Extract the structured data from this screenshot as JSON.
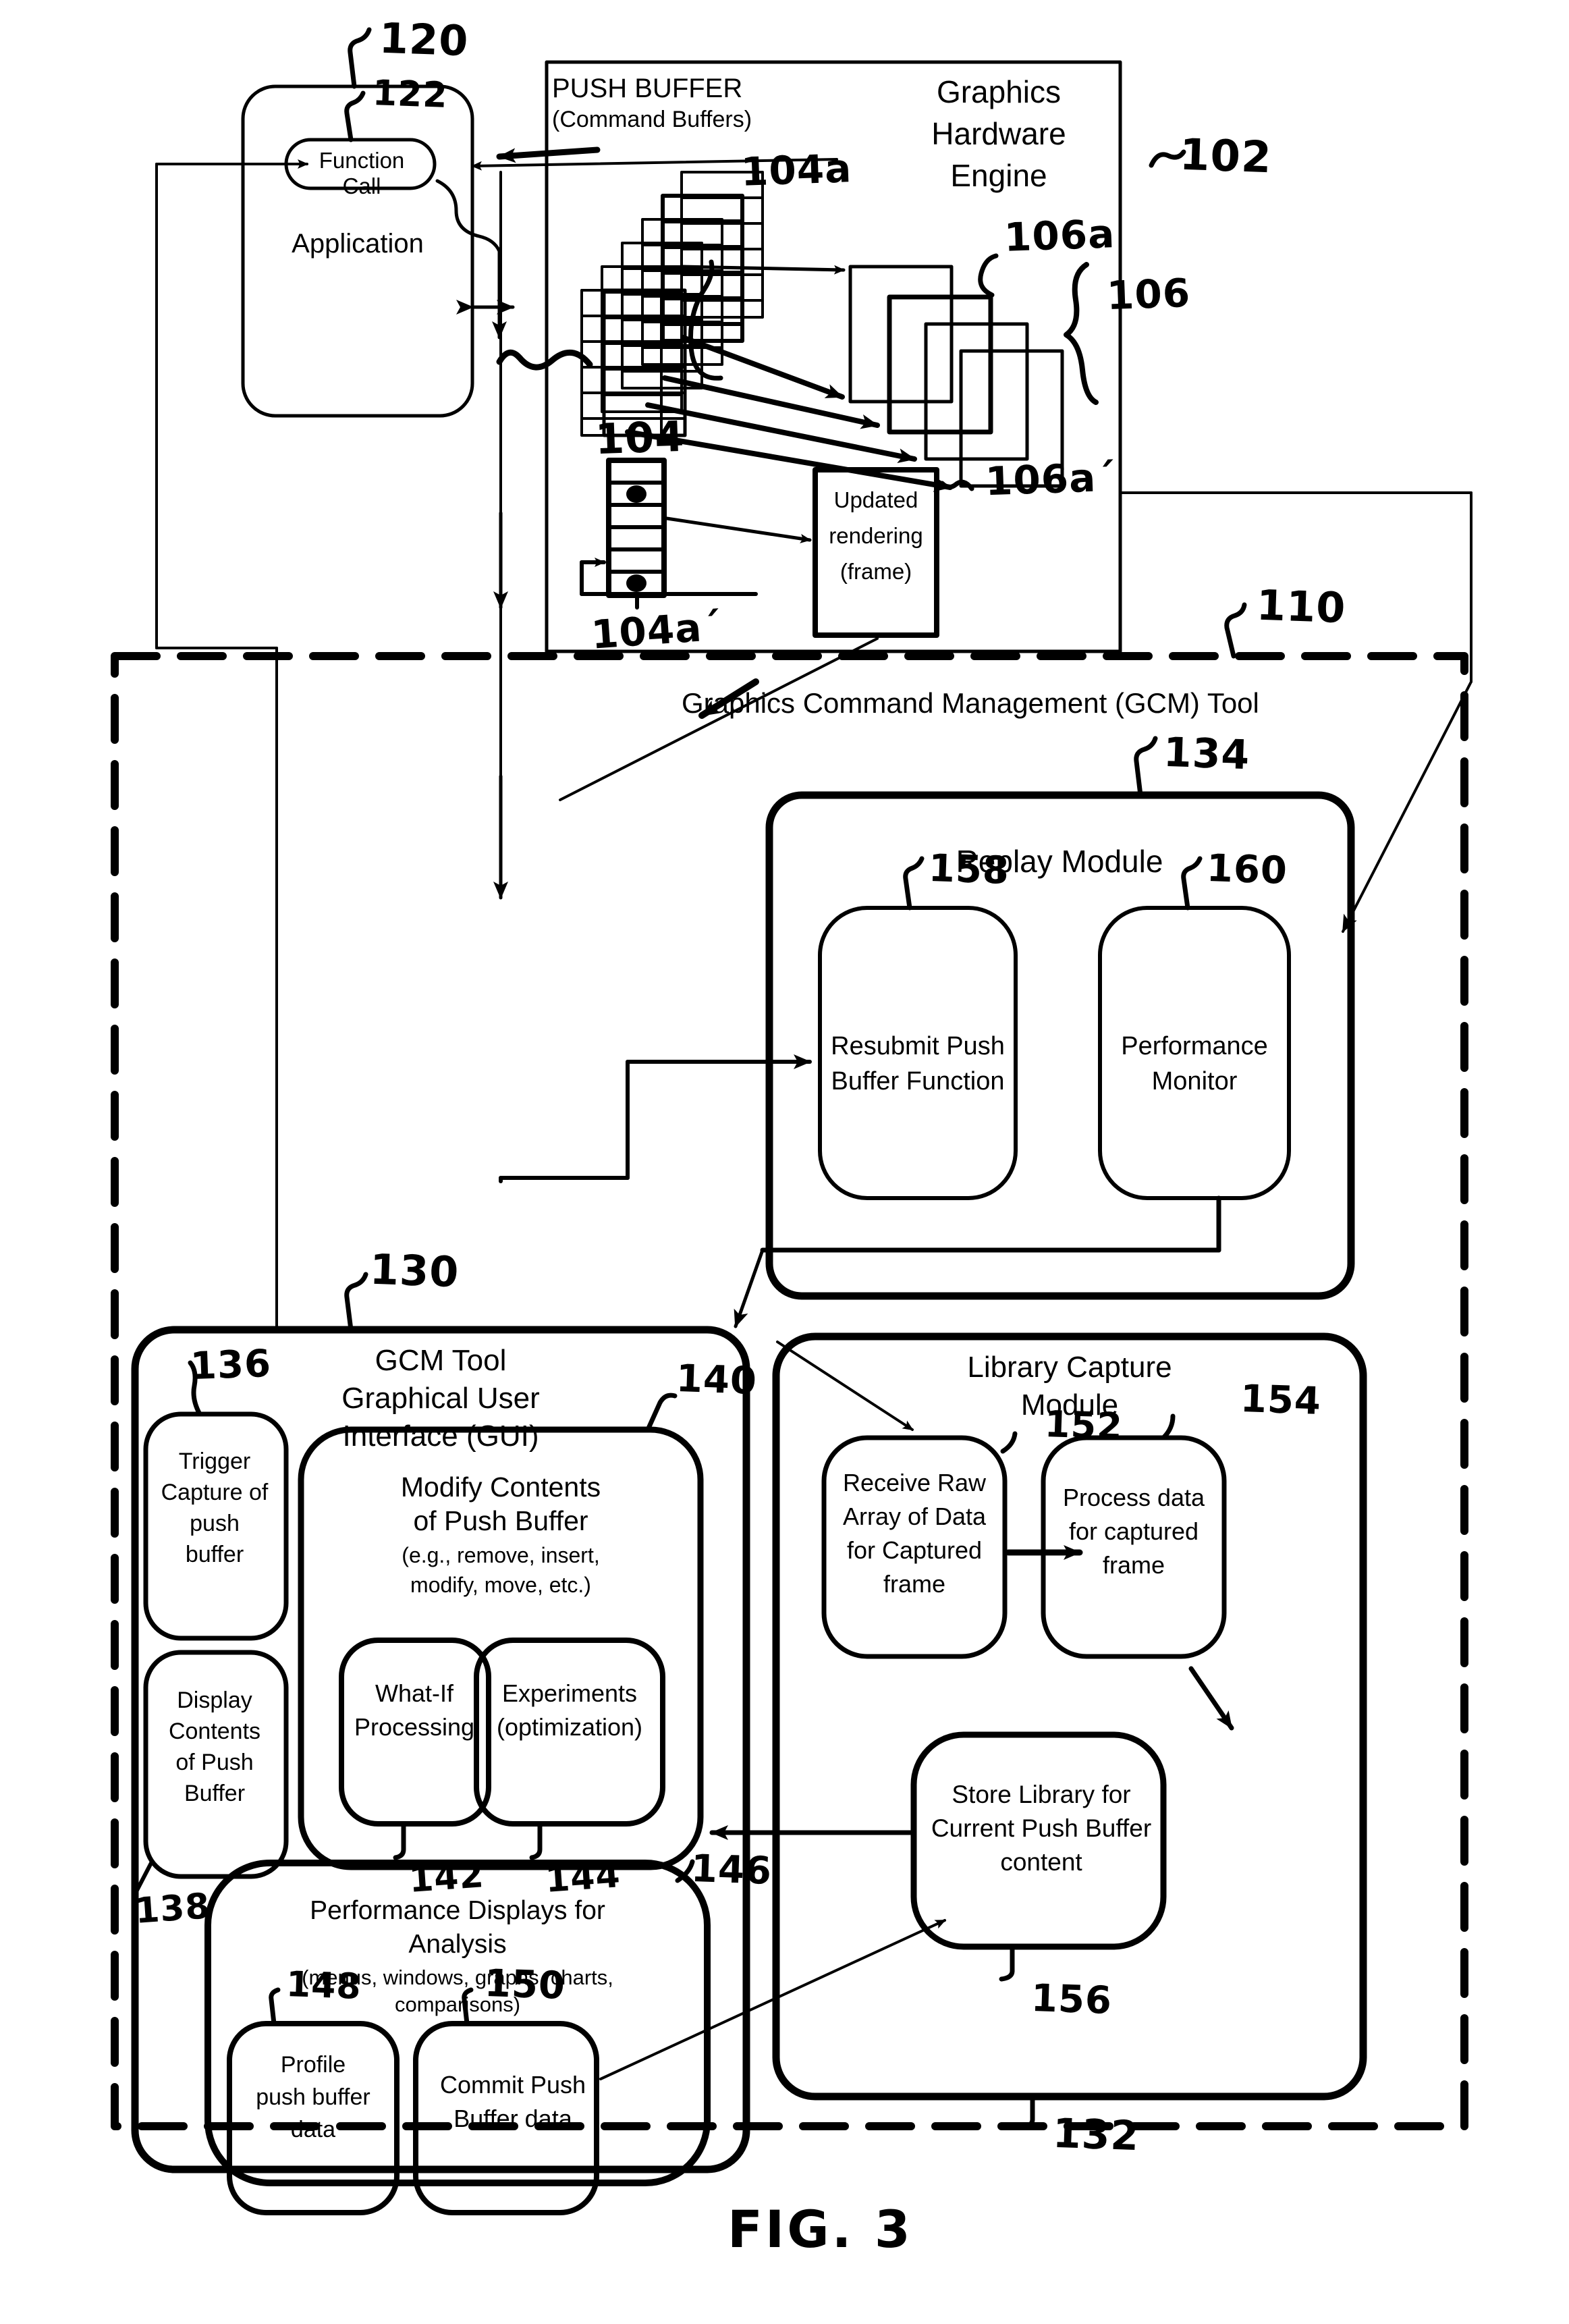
{
  "figure": {
    "caption": "FIG. 3"
  },
  "blocks": {
    "application": {
      "label": "Application",
      "ref": "120"
    },
    "function_call": {
      "label": "Function Call",
      "ref": "122"
    },
    "graphics_hardware_engine": {
      "title_line1": "Graphics",
      "title_line2": "Hardware",
      "title_line3": "Engine",
      "ref": "102"
    },
    "push_buffer": {
      "title": "PUSH BUFFER",
      "subtitle": "(Command Buffers)",
      "ref_stack": "104",
      "ref_single_buffer": "104a",
      "ref_single_buffer_prime": "104a´"
    },
    "frames": {
      "ref_group": "106",
      "ref_one": "106a",
      "ref_updated": "106a´"
    },
    "updated_rendering": {
      "line1": "Updated",
      "line2": "rendering",
      "line3": "(frame)"
    },
    "gcm_tool": {
      "label": "Graphics Command Management (GCM) Tool",
      "ref": "110"
    },
    "replay_module": {
      "label": "Replay Module",
      "ref": "134"
    },
    "resubmit_push_buffer_function": {
      "line1": "Resubmit Push",
      "line2": "Buffer Function",
      "ref": "158"
    },
    "performance_monitor": {
      "line1": "Performance",
      "line2": "Monitor",
      "ref": "160"
    },
    "gcm_gui": {
      "line1": "GCM Tool",
      "line2": "Graphical User",
      "line3": "Interface (GUI)",
      "ref": "130"
    },
    "trigger_capture": {
      "line1": "Trigger",
      "line2": "Capture of",
      "line3": "push",
      "line4": "buffer",
      "ref": "136"
    },
    "display_contents": {
      "line1": "Display",
      "line2": "Contents",
      "line3": "of Push",
      "line4": "Buffer",
      "ref": "138"
    },
    "modify_contents": {
      "line1": "Modify Contents",
      "line2": "of Push Buffer",
      "note1": "(e.g., remove, insert,",
      "note2": "modify, move, etc.)",
      "ref": "140"
    },
    "what_if_processing": {
      "line1": "What-If",
      "line2": "Processing",
      "ref": "142"
    },
    "experiments": {
      "line1": "Experiments",
      "line2": "(optimization)",
      "ref": "144"
    },
    "performance_displays": {
      "line1": "Performance Displays for",
      "line2": "Analysis",
      "note1": "(menus, windows, graphs, charts,",
      "note2": "comparisons)",
      "ref": "146"
    },
    "profile_push_buffer_data": {
      "line1": "Profile",
      "line2": "push buffer",
      "line3": "data",
      "ref": "148"
    },
    "commit_push_buffer_data": {
      "line1": "Commit Push",
      "line2": "Buffer data",
      "ref": "150"
    },
    "library_capture_module": {
      "line1": "Library Capture",
      "line2": "Module",
      "ref": "132"
    },
    "receive_raw_array": {
      "line1": "Receive Raw",
      "line2": "Array of Data",
      "line3": "for Captured",
      "line4": "frame",
      "ref": "152"
    },
    "process_data": {
      "line1": "Process data",
      "line2": "for captured",
      "line3": "frame",
      "ref": "154"
    },
    "store_library": {
      "line1": "Store Library for",
      "line2": "Current Push Buffer",
      "line3": "content",
      "ref": "156"
    }
  },
  "colors": {
    "ink": "#000000",
    "paper": "#ffffff"
  }
}
